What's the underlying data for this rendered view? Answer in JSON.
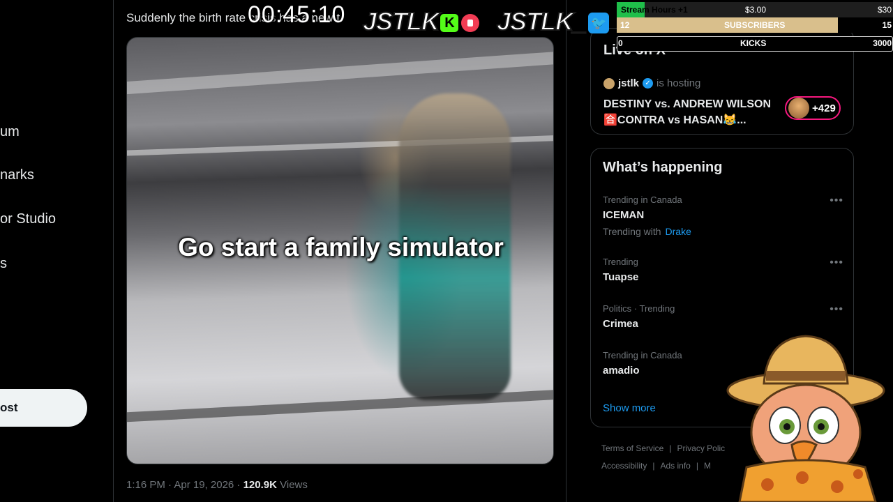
{
  "nav": {
    "items": [
      "um",
      "narks",
      "or Studio",
      "s"
    ],
    "post_label": "ost"
  },
  "tweet": {
    "text": "Suddenly the birth rate crisis has a new t",
    "caption": "Go start a family simulator",
    "time": "1:16 PM · Apr 19, 2026 · ",
    "views_count": "120.9K",
    "views_label": " Views"
  },
  "live": {
    "title": "Live on X",
    "host_name": "jstlk",
    "host_suffix": "is hosting",
    "line1": "DESTINY vs. ANDREW WILSON",
    "line2": "🈴CONTRA vs HASAN😹...",
    "listeners": "+429"
  },
  "happening": {
    "title": "What’s happening",
    "trends": [
      {
        "context": "Trending in Canada",
        "name": "ICEMAN",
        "with_label": "Trending with",
        "with_link": "Drake"
      },
      {
        "context": "Trending",
        "name": "Tuapse"
      },
      {
        "context": "Politics · Trending",
        "name": "Crimea"
      },
      {
        "context": "Trending in Canada",
        "name": "amadio"
      }
    ],
    "show_more": "Show more"
  },
  "footer": {
    "row1": [
      "Terms of Service",
      "Privacy Polic"
    ],
    "row2": [
      "Accessibility",
      "Ads info",
      "M"
    ]
  },
  "overlay": {
    "timer": "00:45:10",
    "logo1": "JSTLK",
    "logo2": "JSTLK_",
    "goals": [
      {
        "label": "Stream Hours +1",
        "mid": "$3.00",
        "end": "$30",
        "progress": 0.1,
        "color": "#1fbf4a"
      },
      {
        "start": "12",
        "label": "SUBSCRIBERS",
        "end": "15",
        "progress": 0.8,
        "color": "#d9bf8c"
      },
      {
        "start": "0",
        "label": "KICKS",
        "end": "3000",
        "progress": 0.0,
        "color": "#ffffff"
      }
    ]
  }
}
